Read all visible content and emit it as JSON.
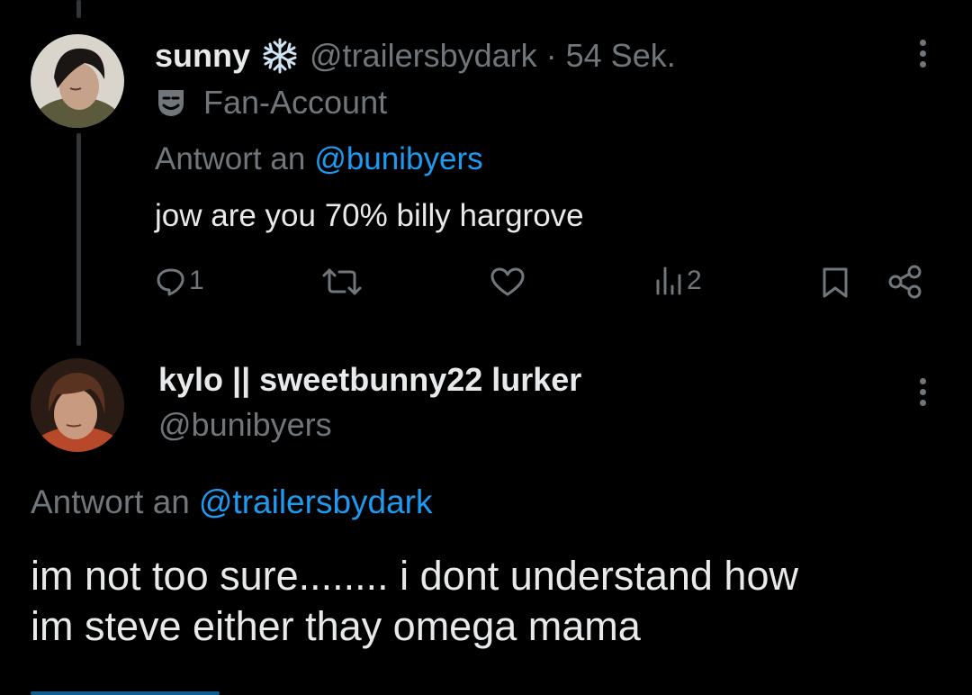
{
  "tweet1": {
    "display_name": "sunny",
    "name_emoji": "❄",
    "handle": "@trailersbydark",
    "separator": "·",
    "time": "54 Sek.",
    "label": "Fan-Account",
    "reply_prefix": "Antwort an",
    "reply_to": "@bunibyers",
    "text": "jow are you 70% billy hargrove",
    "actions": {
      "reply_count": "1",
      "retweet_count": "",
      "like_count": "",
      "views_count": "2"
    }
  },
  "tweet2": {
    "display_name": "kylo || sweetbunny22 lurker",
    "handle": "@bunibyers",
    "reply_prefix": "Antwort an",
    "reply_to": "@trailersbydark",
    "text_line1": "im not too sure........ i dont understand how",
    "text_line2": "im steve either thay omega mama"
  },
  "colors": {
    "background": "#000000",
    "text_primary": "#e7e9ea",
    "text_secondary": "#71767b",
    "link": "#1d9bf0",
    "thread_line": "#333639"
  },
  "icons": [
    "more-icon",
    "theater-mask-icon",
    "snowflake-icon",
    "reply-icon",
    "retweet-icon",
    "like-icon",
    "views-icon",
    "bookmark-icon",
    "share-icon"
  ]
}
